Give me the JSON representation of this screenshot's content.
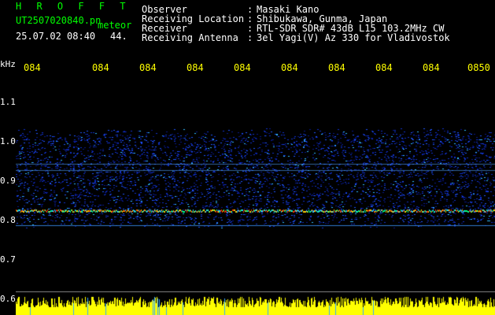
{
  "header": {
    "app_title": "H R O F F T",
    "file_name": "UT2507020840.pn",
    "mode": "meteor",
    "datetime": "25.07.02 08:40",
    "count": "44.",
    "fields": [
      {
        "label": "Observer",
        "value": "Masaki Kano"
      },
      {
        "label": "Receiving Location",
        "value": "Shibukawa, Gunma, Japan"
      },
      {
        "label": "Receiver",
        "value": "RTL-SDR SDR# 43dB L15 103.2MHz CW"
      },
      {
        "label": "Receiving Antenna",
        "value": "3el Yagi(V) Az 330 for Vladivostok"
      }
    ],
    "separator": ":"
  },
  "axes": {
    "y_unit": "kHz",
    "y_ticks": [
      "1.1",
      "1.0",
      "0.9",
      "0.8",
      "0.7",
      "0.6"
    ],
    "x_ticks": [
      "084",
      "084",
      "084",
      "084",
      "084",
      "084",
      "084",
      "084",
      "084",
      "0850"
    ]
  },
  "colors": {
    "background": "#000000",
    "title": "#00ff00",
    "text": "#ffffff",
    "x_ticks": "#ffff00",
    "noise_low": "#0000aa",
    "noise_high": "#2266ff",
    "echo_line": "#ff3300",
    "activity_bars": "#ffff00"
  }
}
